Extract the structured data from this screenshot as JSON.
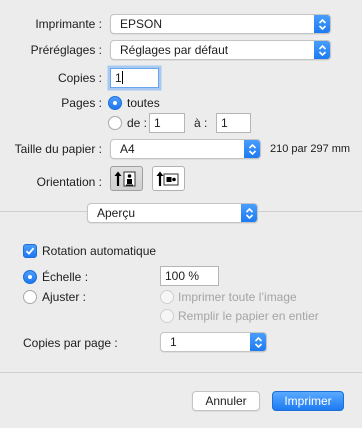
{
  "printer": {
    "label": "Imprimante :",
    "value": "EPSON"
  },
  "presets": {
    "label": "Préréglages :",
    "value": "Réglages par défaut"
  },
  "copies": {
    "label": "Copies :",
    "value": "1"
  },
  "pages": {
    "label": "Pages :",
    "all_label": "toutes",
    "from_label": "de :",
    "from_value": "1",
    "to_label": "à :",
    "to_value": "1",
    "selected": "toutes"
  },
  "paper_size": {
    "label": "Taille du papier :",
    "value": "A4",
    "dimensions": "210 par 297 mm"
  },
  "orientation": {
    "label": "Orientation :",
    "options": [
      "portrait-icon",
      "landscape-icon"
    ],
    "selected": "portrait-icon"
  },
  "section_menu": {
    "value": "Aperçu"
  },
  "preview_options": {
    "auto_rotate_label": "Rotation automatique",
    "auto_rotate_checked": true,
    "scale_label": "Échelle :",
    "scale_value": "100 %",
    "fit_label": "Ajuster :",
    "fit_options": [
      "Imprimer toute l’image",
      "Remplir le papier en entier"
    ],
    "selected_mode": "Échelle"
  },
  "copies_per_page": {
    "label": "Copies par page :",
    "value": "1"
  },
  "buttons": {
    "cancel": "Annuler",
    "print": "Imprimer"
  },
  "colors": {
    "accent": "#1d7bf2",
    "background": "#ececec"
  }
}
